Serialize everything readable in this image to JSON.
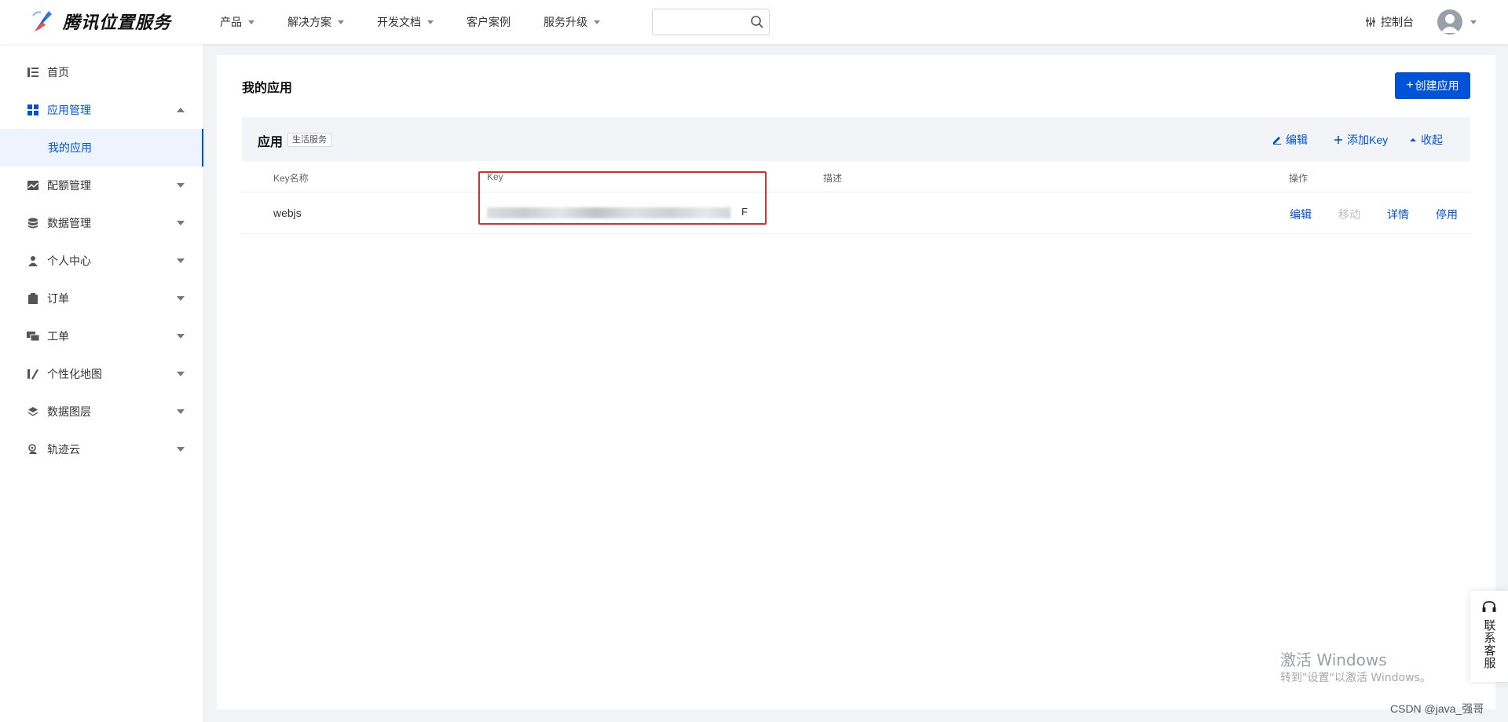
{
  "header": {
    "brand": "腾讯位置服务",
    "nav": [
      {
        "label": "产品",
        "has_caret": true
      },
      {
        "label": "解决方案",
        "has_caret": true
      },
      {
        "label": "开发文档",
        "has_caret": true
      },
      {
        "label": "客户案例",
        "has_caret": false
      },
      {
        "label": "服务升级",
        "has_caret": true
      }
    ],
    "search": {
      "value": "",
      "placeholder": ""
    },
    "console_label": "控制台",
    "brand_color": "#0052d9"
  },
  "sidebar": {
    "items": [
      {
        "label": "首页",
        "icon": "home-list-icon"
      },
      {
        "label": "应用管理",
        "icon": "grid-apps-icon",
        "expanded": true
      },
      {
        "label": "我的应用",
        "sub": true,
        "selected": true
      },
      {
        "label": "配额管理",
        "icon": "quota-chart-icon"
      },
      {
        "label": "数据管理",
        "icon": "database-icon"
      },
      {
        "label": "个人中心",
        "icon": "user-icon"
      },
      {
        "label": "订单",
        "icon": "clipboard-icon"
      },
      {
        "label": "工单",
        "icon": "ticket-icon"
      },
      {
        "label": "个性化地图",
        "icon": "map-style-icon"
      },
      {
        "label": "数据图层",
        "icon": "layers-icon"
      },
      {
        "label": "轨迹云",
        "icon": "track-cloud-icon"
      }
    ]
  },
  "main": {
    "title": "我的应用",
    "create_button": "创建应用",
    "app": {
      "name": "应用",
      "tag": "生活服务",
      "actions": {
        "edit": "编辑",
        "add_key": "添加Key",
        "collapse": "收起"
      }
    },
    "table": {
      "headers": {
        "key_name": "Key名称",
        "key": "Key",
        "desc": "描述",
        "ops": "操作"
      },
      "rows": [
        {
          "key_name": "webjs",
          "key_tail": "F",
          "desc": "",
          "actions": {
            "edit": "编辑",
            "move": "移动",
            "detail": "详情",
            "disable": "停用"
          }
        }
      ]
    }
  },
  "service": {
    "label": "联系客服"
  },
  "watermark": {
    "title": "激活 Windows",
    "subtitle": "转到\"设置\"以激活 Windows。",
    "csdn": "CSDN @java_强哥"
  }
}
